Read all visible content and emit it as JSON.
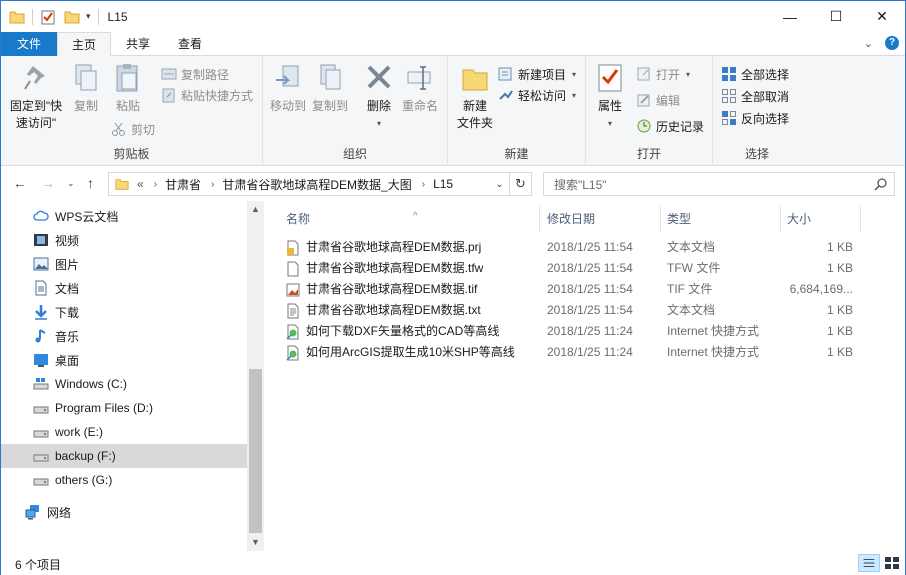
{
  "window": {
    "title": "L15",
    "minimize": "—",
    "maximize": "☐",
    "close": "✕"
  },
  "tabs": {
    "file": "文件",
    "home": "主页",
    "share": "共享",
    "view": "查看",
    "expand": "⌄",
    "help": "?"
  },
  "ribbon": {
    "clipboard": {
      "pin": "固定到\"快\n速访问\"",
      "copy": "复制",
      "paste": "粘贴",
      "copy_path": "复制路径",
      "paste_shortcut": "粘贴快捷方式",
      "cut": "剪切",
      "label": "剪贴板"
    },
    "organize": {
      "move_to": "移动到",
      "copy_to": "复制到",
      "delete": "删除",
      "rename": "重命名",
      "label": "组织"
    },
    "new": {
      "new_folder": "新建\n文件夹",
      "new_item": "新建项目",
      "easy_access": "轻松访问",
      "label": "新建"
    },
    "open": {
      "properties": "属性",
      "open": "打开",
      "edit": "编辑",
      "history": "历史记录",
      "label": "打开"
    },
    "select": {
      "select_all": "全部选择",
      "select_none": "全部取消",
      "invert": "反向选择",
      "label": "选择"
    }
  },
  "address": {
    "overflow": "«",
    "crumbs": [
      "甘肃省",
      "甘肃省谷歌地球高程DEM数据_大图",
      "L15"
    ],
    "search_placeholder": "搜索\"L15\""
  },
  "nav": {
    "items": [
      {
        "label": "WPS云文档",
        "icon": "cloud-icon"
      },
      {
        "label": "视频",
        "icon": "video-icon"
      },
      {
        "label": "图片",
        "icon": "pictures-icon"
      },
      {
        "label": "文档",
        "icon": "documents-icon"
      },
      {
        "label": "下载",
        "icon": "download-icon"
      },
      {
        "label": "音乐",
        "icon": "music-icon"
      },
      {
        "label": "桌面",
        "icon": "desktop-icon"
      },
      {
        "label": "Windows (C:)",
        "icon": "windows-drive-icon"
      },
      {
        "label": "Program Files (D:)",
        "icon": "drive-icon"
      },
      {
        "label": "work (E:)",
        "icon": "drive-icon"
      },
      {
        "label": "backup (F:)",
        "icon": "drive-icon",
        "selected": true
      },
      {
        "label": "others (G:)",
        "icon": "drive-icon"
      },
      {
        "label": "网络",
        "icon": "network-icon"
      }
    ]
  },
  "columns": {
    "name": "名称",
    "date": "修改日期",
    "type": "类型",
    "size": "大小"
  },
  "files": [
    {
      "name": "甘肃省谷歌地球高程DEM数据.prj",
      "date": "2018/1/25 11:54",
      "type": "文本文档",
      "size": "1 KB",
      "icon": "text-file-icon"
    },
    {
      "name": "甘肃省谷歌地球高程DEM数据.tfw",
      "date": "2018/1/25 11:54",
      "type": "TFW 文件",
      "size": "1 KB",
      "icon": "blank-file-icon"
    },
    {
      "name": "甘肃省谷歌地球高程DEM数据.tif",
      "date": "2018/1/25 11:54",
      "type": "TIF 文件",
      "size": "6,684,169...",
      "icon": "image-file-icon"
    },
    {
      "name": "甘肃省谷歌地球高程DEM数据.txt",
      "date": "2018/1/25 11:54",
      "type": "文本文档",
      "size": "1 KB",
      "icon": "text-file-icon"
    },
    {
      "name": "如何下载DXF矢量格式的CAD等高线",
      "date": "2018/1/25 11:24",
      "type": "Internet 快捷方式",
      "size": "1 KB",
      "icon": "internet-shortcut-icon"
    },
    {
      "name": "如何用ArcGIS提取生成10米SHP等高线",
      "date": "2018/1/25 11:24",
      "type": "Internet 快捷方式",
      "size": "1 KB",
      "icon": "internet-shortcut-icon"
    }
  ],
  "status": {
    "count": "6 个项目"
  }
}
